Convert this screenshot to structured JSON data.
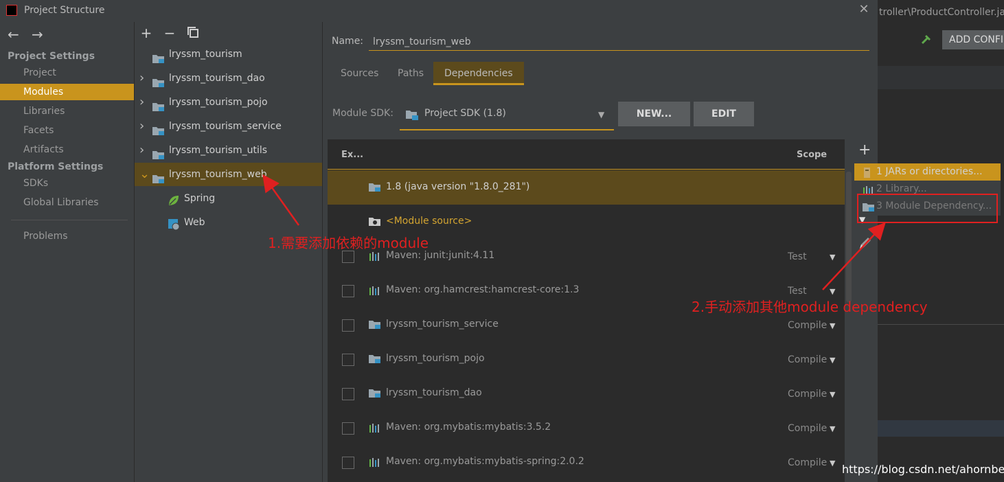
{
  "window": {
    "title": "Project Structure"
  },
  "background": {
    "editor_path": "troller\\ProductController.ja",
    "add_config_label": "ADD CONFI"
  },
  "left_nav": {
    "project_settings_title": "Project Settings",
    "project_settings": [
      "Project",
      "Modules",
      "Libraries",
      "Facets",
      "Artifacts"
    ],
    "platform_settings_title": "Platform Settings",
    "platform_settings": [
      "SDKs",
      "Global Libraries"
    ],
    "problems": "Problems",
    "selected": "Modules"
  },
  "module_tree": {
    "items": [
      {
        "label": "lryssm_tourism",
        "expandable": false,
        "icon": "module-folder-icon"
      },
      {
        "label": "lryssm_tourism_dao",
        "expandable": true,
        "icon": "module-folder-icon"
      },
      {
        "label": "lryssm_tourism_pojo",
        "expandable": true,
        "icon": "module-folder-icon"
      },
      {
        "label": "lryssm_tourism_service",
        "expandable": true,
        "icon": "module-folder-icon"
      },
      {
        "label": "lryssm_tourism_utils",
        "expandable": true,
        "icon": "module-folder-icon"
      },
      {
        "label": "lryssm_tourism_web",
        "expandable": true,
        "expanded": true,
        "selected": true,
        "icon": "module-folder-icon"
      },
      {
        "label": "Spring",
        "child": true,
        "icon": "spring-leaf-icon"
      },
      {
        "label": "Web",
        "child": true,
        "icon": "web-icon"
      }
    ]
  },
  "module_detail": {
    "name_label": "Name:",
    "name_value": "lryssm_tourism_web",
    "tabs": [
      "Sources",
      "Paths",
      "Dependencies"
    ],
    "active_tab": "Dependencies",
    "sdk_label": "Module SDK:",
    "sdk_value": "Project SDK (1.8)",
    "new_button": "NEW...",
    "edit_button": "EDIT"
  },
  "dependencies": {
    "header_export": "Ex...",
    "header_scope": "Scope",
    "rows": [
      {
        "label": "1.8 (java version \"1.8.0_281\")",
        "checkbox": false,
        "scope": "",
        "icon": "sdk-folder-icon",
        "selected": true,
        "style": "bright"
      },
      {
        "label": "<Module source>",
        "checkbox": false,
        "scope": "",
        "icon": "source-folder-icon",
        "style": "orange"
      },
      {
        "label": "Maven: junit:junit:4.11",
        "checkbox": true,
        "scope": "Test",
        "icon": "library-icon"
      },
      {
        "label": "Maven: org.hamcrest:hamcrest-core:1.3",
        "checkbox": true,
        "scope": "Test",
        "icon": "library-icon"
      },
      {
        "label": "lryssm_tourism_service",
        "checkbox": true,
        "scope": "Compile",
        "icon": "module-folder-icon"
      },
      {
        "label": "lryssm_tourism_pojo",
        "checkbox": true,
        "scope": "Compile",
        "icon": "module-folder-icon"
      },
      {
        "label": "lryssm_tourism_dao",
        "checkbox": true,
        "scope": "Compile",
        "icon": "module-folder-icon"
      },
      {
        "label": "Maven: org.mybatis:mybatis:3.5.2",
        "checkbox": true,
        "scope": "Compile",
        "icon": "library-icon"
      },
      {
        "label": "Maven: org.mybatis:mybatis-spring:2.0.2",
        "checkbox": true,
        "scope": "Compile",
        "icon": "library-icon"
      }
    ]
  },
  "add_popup": {
    "items": [
      {
        "label": "1  JARs or directories...",
        "icon": "jar-icon",
        "selected": true
      },
      {
        "label": "2  Library...",
        "icon": "library-icon"
      },
      {
        "label": "3  Module Dependency...",
        "icon": "module-folder-icon"
      }
    ]
  },
  "annotations": {
    "step1": "1.需要添加依赖的module",
    "step2": "2.手动添加其他module dependency"
  },
  "watermark": "https://blog.csdn.net/ahornbeast",
  "colors": {
    "accent": "#c9941d",
    "selection_dark": "#5c4a1c",
    "annotation_red": "#e02020",
    "panel": "#3c3f41"
  }
}
